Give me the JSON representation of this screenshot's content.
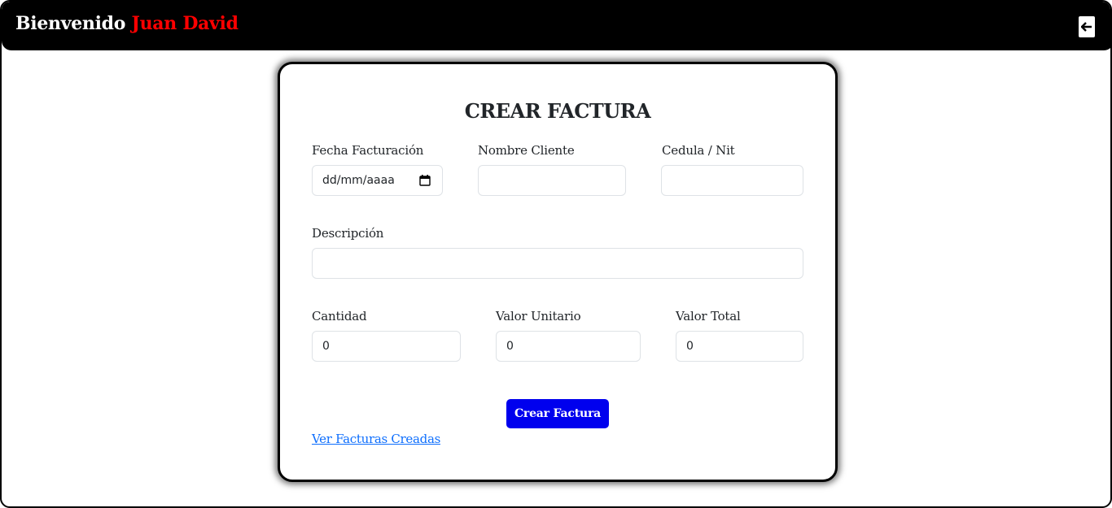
{
  "header": {
    "greeting": "Bienvenido",
    "user_name": "Juan David",
    "logout_icon": "arrow-left-icon"
  },
  "form": {
    "title": "CREAR FACTURA",
    "fecha": {
      "label": "Fecha Facturación",
      "placeholder": "dd/mm/aaaa",
      "icon": "calendar-icon"
    },
    "nombre": {
      "label": "Nombre Cliente",
      "value": ""
    },
    "cedula": {
      "label": "Cedula / Nit",
      "value": ""
    },
    "descripcion": {
      "label": "Descripción",
      "value": ""
    },
    "cantidad": {
      "label": "Cantidad",
      "value": "0"
    },
    "valor_unitario": {
      "label": "Valor Unitario",
      "value": "0"
    },
    "valor_total": {
      "label": "Valor Total",
      "value": "0"
    },
    "submit_label": "Crear Factura",
    "link_label": "Ver Facturas Creadas"
  },
  "colors": {
    "header_bg": "#000000",
    "user_name": "#ff0000",
    "submit_bg": "#0000ee",
    "link": "#0d6efd"
  }
}
